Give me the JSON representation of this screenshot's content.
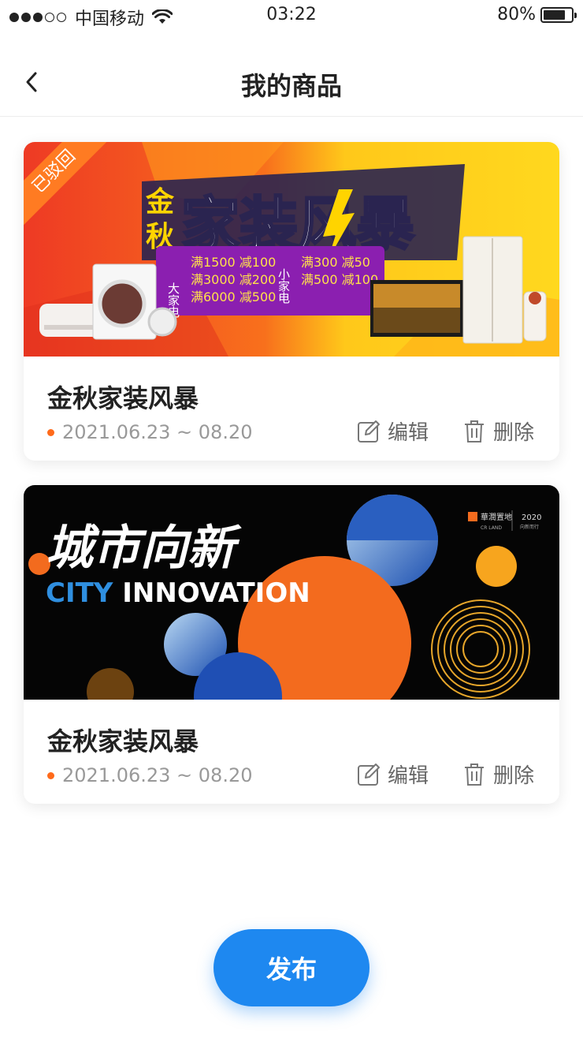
{
  "status_bar": {
    "carrier": "中国移动",
    "time": "03:22",
    "battery": "80%",
    "battery_level": 0.8
  },
  "header": {
    "title": "我的商品"
  },
  "products": [
    {
      "status_badge": "已驳回",
      "banner": {
        "prefix": "金秋",
        "headline": "家装风暴",
        "promo_left_label": "大家电",
        "promo_left": [
          "满1500 减100",
          "满3000 减200",
          "满6000 减500"
        ],
        "promo_right_label": "小家电",
        "promo_right": [
          "满300 减50",
          "满500 减100"
        ]
      },
      "title": "金秋家装风暴",
      "date_range": "2021.06.23 ~ 08.20",
      "edit_label": "编辑",
      "delete_label": "删除"
    },
    {
      "banner": {
        "headline": "城市向新",
        "subline_city": "CITY",
        "subline_rest": " INNOVATION",
        "brand": "華潤置地",
        "brand_en": "CR LAND",
        "year": "2020",
        "year_sub": "向新而行"
      },
      "title": "金秋家装风暴",
      "date_range": "2021.06.23 ~ 08.20",
      "edit_label": "编辑",
      "delete_label": "删除"
    }
  ],
  "publish_label": "发布",
  "colors": {
    "accent": "#1e88f0",
    "date_dot": "#ff6a1a",
    "ribbon": "#ff7b22"
  }
}
